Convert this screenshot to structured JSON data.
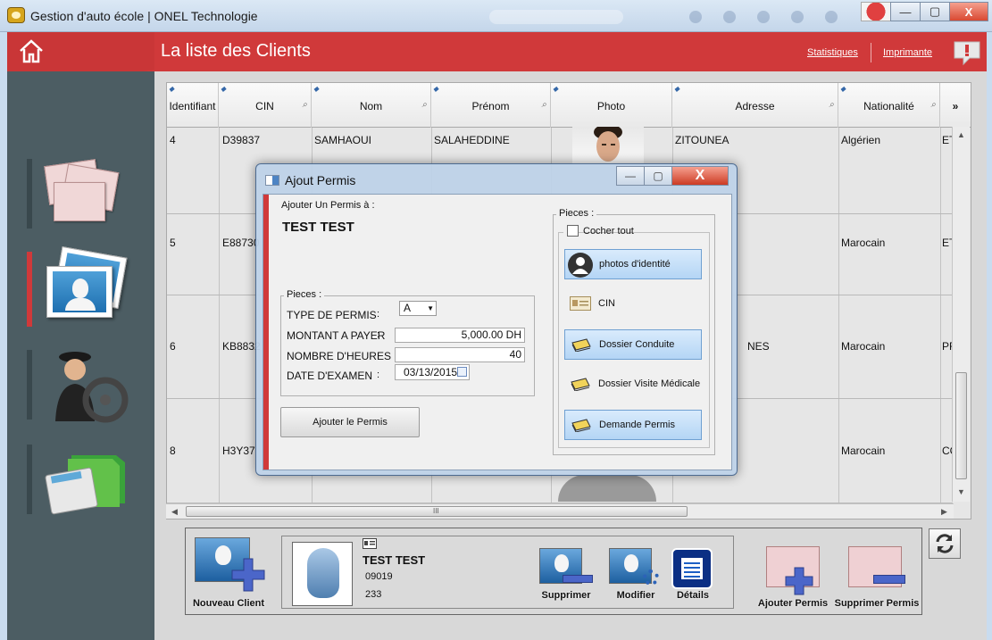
{
  "window": {
    "title": "Gestion d'auto école | ONEL Technologie",
    "minimize": "—",
    "maximize": "▢",
    "close": "X"
  },
  "header": {
    "title": "La liste des Clients",
    "link_stats": "Statistiques",
    "link_print": "Imprimante"
  },
  "grid": {
    "columns": [
      "Identifiant",
      "CIN",
      "Nom",
      "Prénom",
      "Photo",
      "Adresse",
      "Nationalité"
    ],
    "more": "»",
    "rows": [
      {
        "id": "4",
        "cin": "D39837",
        "nom": "SAMHAOUI",
        "prenom": "SALAHEDDINE",
        "adresse": "ZITOUNEA",
        "nationalite": "Algérien",
        "extra": "ET"
      },
      {
        "id": "5",
        "cin": "E88730",
        "nationalite": "Marocain",
        "extra": "ET"
      },
      {
        "id": "6",
        "cin": "KB8832",
        "adresse_part": "NES",
        "nationalite": "Marocain",
        "extra": "PF"
      },
      {
        "id": "8",
        "cin": "H3Y37",
        "nationalite": "Marocain",
        "extra": "CC"
      }
    ],
    "hscroll_grip": "III"
  },
  "client": {
    "name": "TEST TEST",
    "line1": "09019",
    "line2": "233"
  },
  "bottom": {
    "nouveau": "Nouveau Client",
    "supprimer": "Supprimer",
    "modifier": "Modifier",
    "details": "Détails",
    "ajouter_permis": "Ajouter Permis",
    "supprimer_permis": "Supprimer Permis"
  },
  "dialog": {
    "title": "Ajout Permis",
    "subtitle": "Ajouter Un Permis à :",
    "client_name": "TEST TEST",
    "pieces_left": "Pieces :",
    "type_label": "TYPE DE PERMIS",
    "type_value": "A",
    "montant_label": "MONTANT A PAYER",
    "montant_value": "5,000.00 DH",
    "heures_label": "NOMBRE D'HEURES",
    "heures_value": "40",
    "date_label": "DATE D'EXAMEN",
    "date_value": "03/13/2015",
    "colon": ":",
    "submit": "Ajouter le Permis",
    "pieces_right": "Pieces :",
    "cocher": "Cocher tout",
    "pieces": [
      "photos d'identité",
      "CIN",
      "Dossier Conduite",
      "Dossier Visite Médicale",
      "Demande Permis"
    ]
  }
}
